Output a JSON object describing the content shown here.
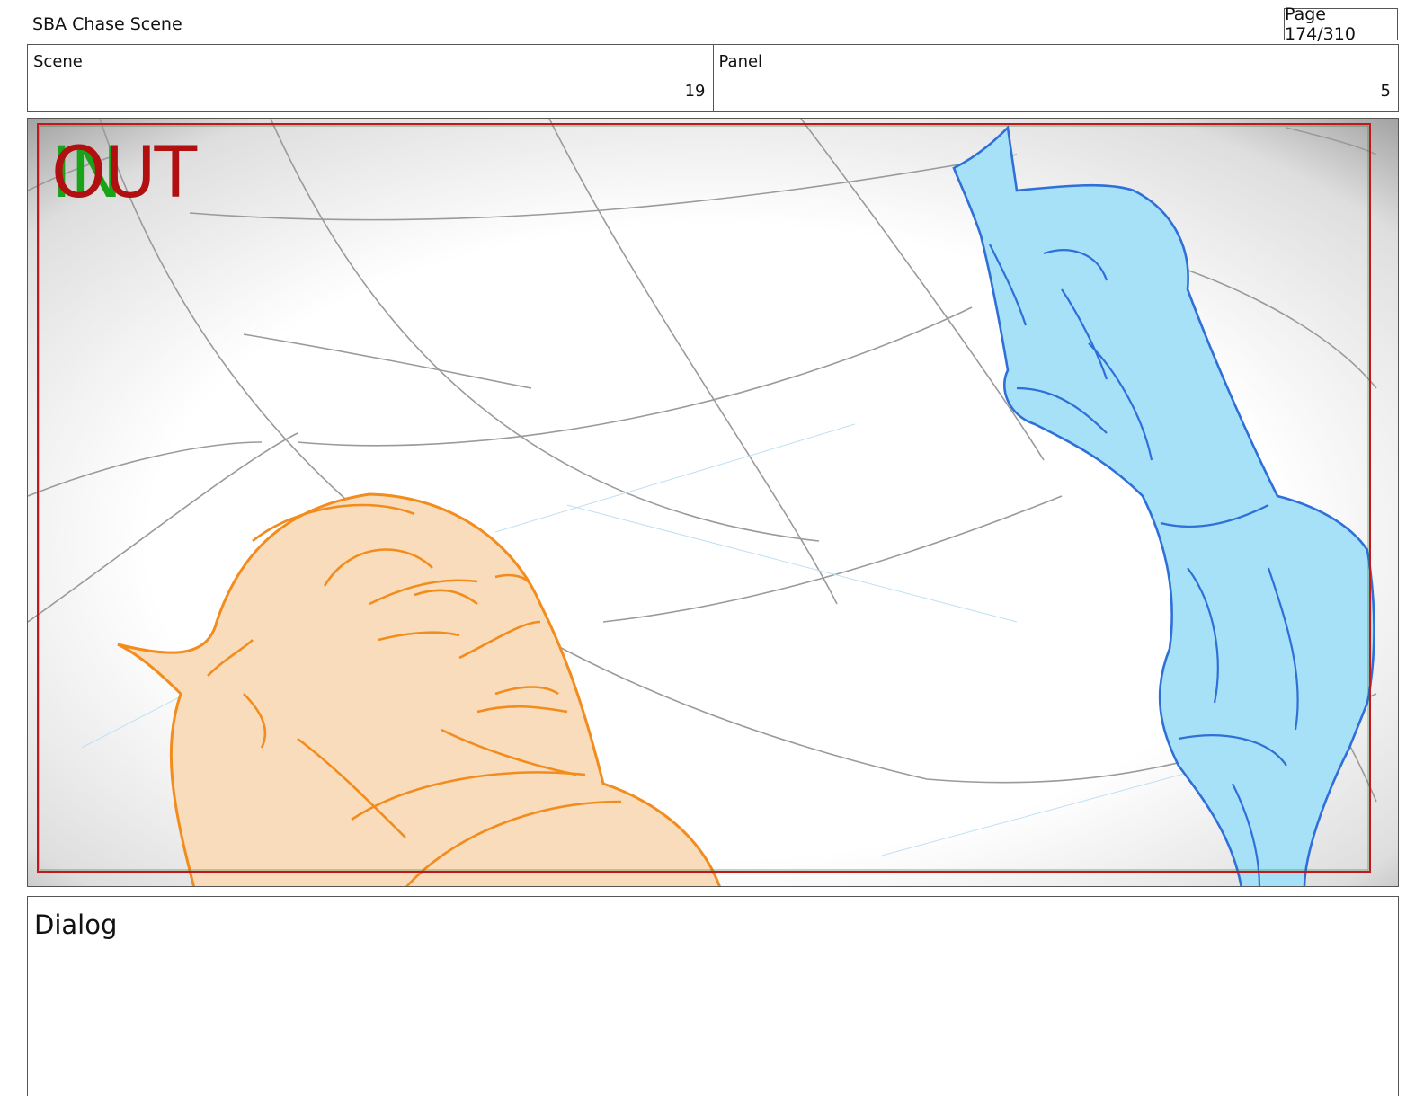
{
  "header": {
    "title": "SBA Chase Scene",
    "page": "Page 174/310"
  },
  "info": {
    "scene_label": "Scene",
    "scene_value": "19",
    "panel_label": "Panel",
    "panel_value": "5"
  },
  "panel": {
    "in_marker": "IN",
    "out_marker": "OUT"
  },
  "dialog": {
    "label": "Dialog"
  },
  "colors": {
    "in_marker": "#19a319",
    "out_marker": "#b01010",
    "character_left": "#f28c1c",
    "character_right": "#2f6fd8"
  }
}
